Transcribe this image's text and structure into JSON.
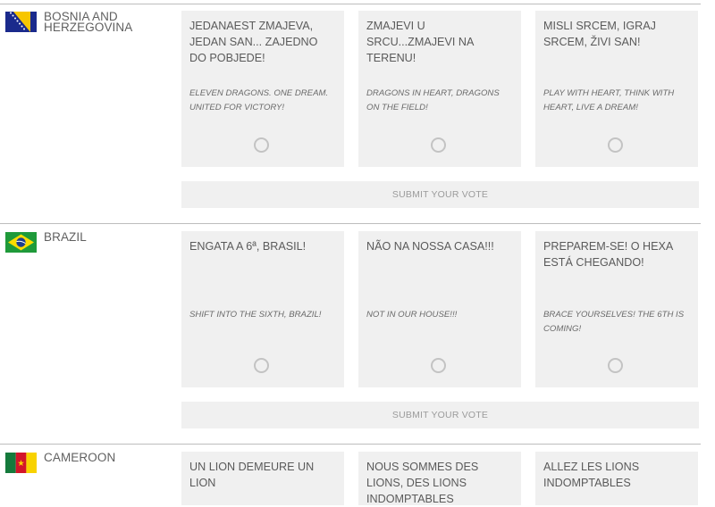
{
  "countries": [
    {
      "name": "BOSNIA AND HERZEGOVINA",
      "flag_icon": "bosnia-flag-icon",
      "options": [
        {
          "slogan": "JEDANAEST ZMAJEVA, JEDAN SAN... ZAJEDNO DO POBJEDE!",
          "translation": "ELEVEN DRAGONS. ONE DREAM. UNITED FOR VICTORY!"
        },
        {
          "slogan": "ZMAJEVI U SRCU...ZMAJEVI NA TERENU!",
          "translation": "DRAGONS IN HEART, DRAGONS ON THE FIELD!"
        },
        {
          "slogan": "MISLI SRCEM, IGRAJ SRCEM, ŽIVI SAN!",
          "translation": "PLAY WITH HEART, THINK WITH HEART, LIVE A DREAM!"
        }
      ],
      "submit_label": "SUBMIT YOUR VOTE"
    },
    {
      "name": "BRAZIL",
      "flag_icon": "brazil-flag-icon",
      "options": [
        {
          "slogan": "ENGATA A 6ª, BRASIL!",
          "translation": "SHIFT INTO THE SIXTH, BRAZIL!"
        },
        {
          "slogan": "NÃO NA NOSSA CASA!!!",
          "translation": "NOT IN OUR HOUSE!!!"
        },
        {
          "slogan": "PREPAREM-SE! O HEXA ESTÁ CHEGANDO!",
          "translation": "BRACE YOURSELVES! THE 6TH IS COMING!"
        }
      ],
      "submit_label": "SUBMIT YOUR VOTE"
    },
    {
      "name": "CAMEROON",
      "flag_icon": "cameroon-flag-icon",
      "options": [
        {
          "slogan": "UN LION DEMEURE UN LION"
        },
        {
          "slogan": "NOUS SOMMES DES LIONS, DES LIONS INDOMPTABLES"
        },
        {
          "slogan": "ALLEZ LES LIONS INDOMPTABLES"
        }
      ]
    }
  ],
  "colors": {
    "card_bg": "#f0f0f0",
    "divider": "#bdbdbd",
    "bosnia_blue": "#1a2a8c",
    "bosnia_yellow": "#f7c600",
    "brazil_green": "#1f9a3a",
    "brazil_yellow": "#fcdc00",
    "brazil_blue": "#1d3d8f",
    "cameroon_green": "#157a3c",
    "cameroon_red": "#d3152a",
    "cameroon_yellow": "#f8d200"
  }
}
